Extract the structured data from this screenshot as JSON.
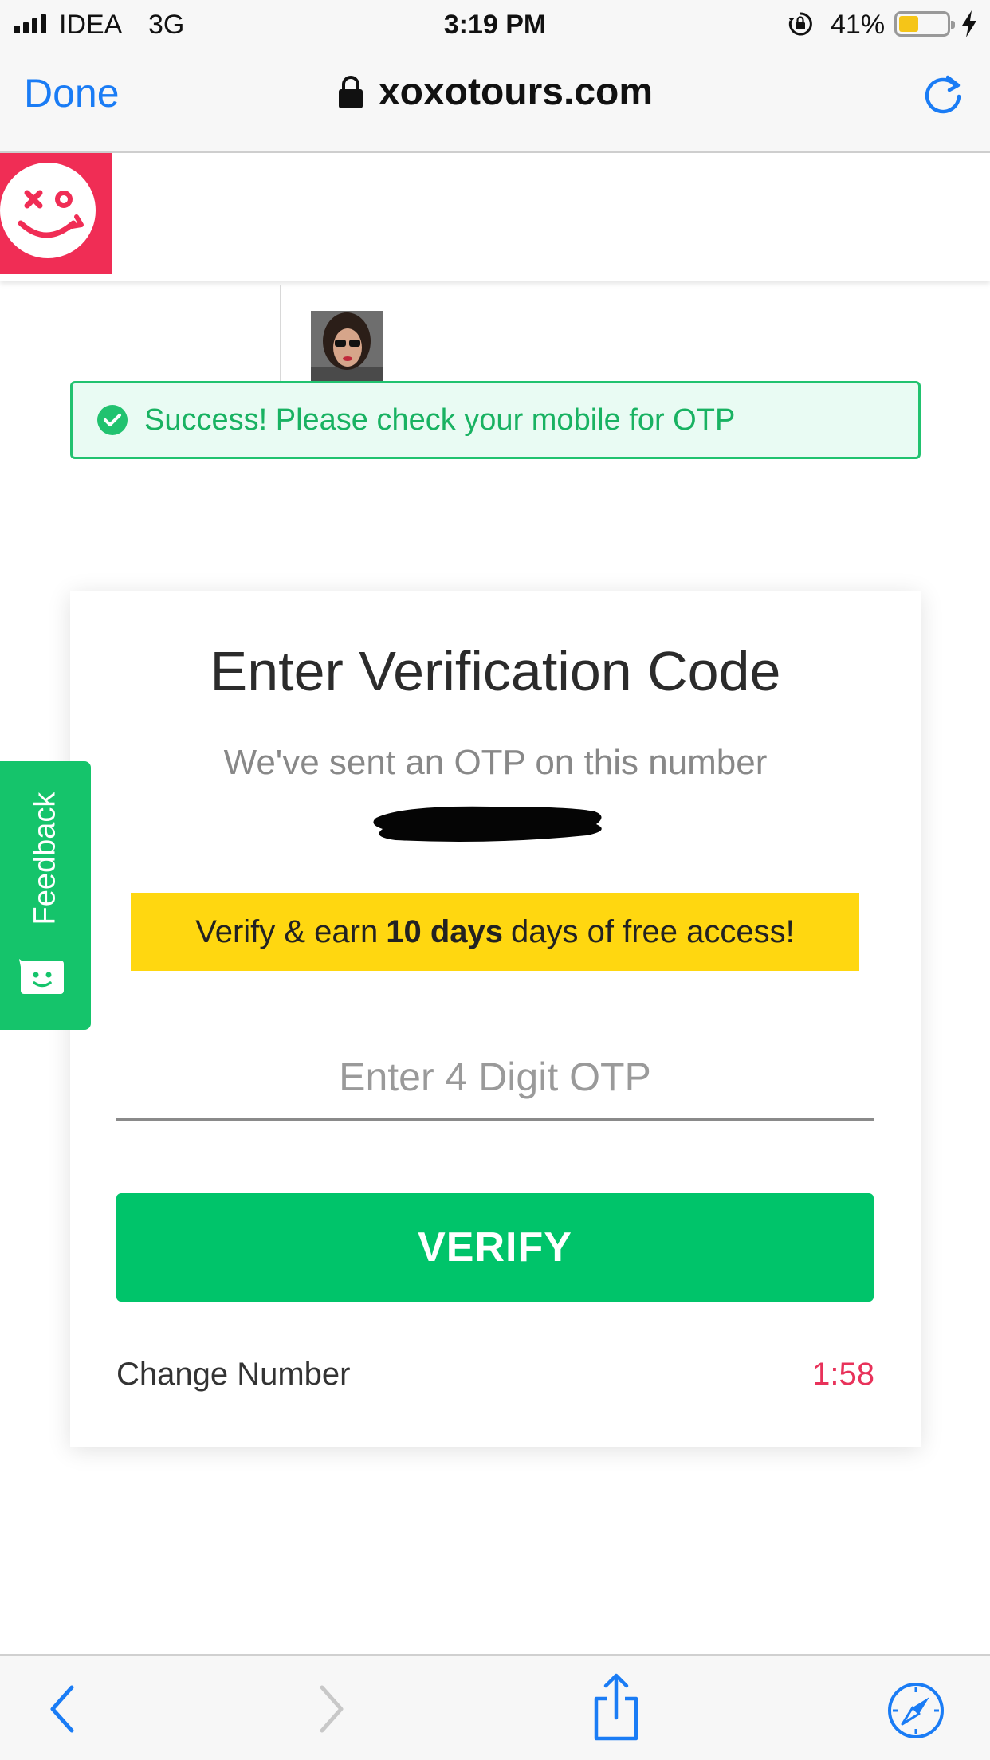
{
  "status_bar": {
    "carrier": "IDEA",
    "network": "3G",
    "time": "3:19 PM",
    "battery_percent": "41%",
    "battery_level": 0.41
  },
  "browser": {
    "done_label": "Done",
    "url": "xoxotours.com"
  },
  "alert": {
    "message": "Success! Please check your mobile for OTP"
  },
  "card": {
    "title": "Enter Verification Code",
    "subtitle": "We've sent an OTP on this number",
    "promo_prefix": "Verify & earn",
    "promo_bold": "10 days",
    "promo_suffix": "days of free access!",
    "otp_placeholder": "Enter 4 Digit OTP",
    "verify_label": "VERIFY",
    "change_number_label": "Change Number",
    "timer": "1:58"
  },
  "feedback": {
    "label": "Feedback"
  },
  "colors": {
    "brand": "#f02d55",
    "success": "#21c26f",
    "verify_button": "#00c46a",
    "promo_bg": "#ffd710",
    "link_blue": "#1a7cf5",
    "timer_red": "#e8325a"
  },
  "icons": [
    "signal-icon",
    "orientation-lock-icon",
    "battery-icon",
    "charging-icon",
    "lock-icon",
    "reload-icon",
    "logo-icon",
    "check-circle-icon",
    "feedback-face-icon",
    "back-icon",
    "forward-icon",
    "share-icon",
    "safari-compass-icon"
  ]
}
